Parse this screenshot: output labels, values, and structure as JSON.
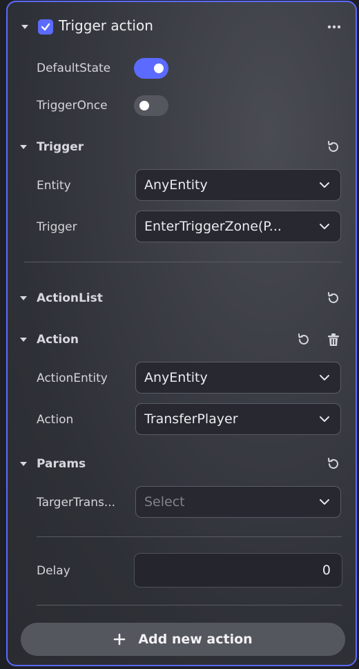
{
  "header": {
    "title": "Trigger action",
    "checked": true,
    "more_icon": "more-horizontal-icon"
  },
  "toggles": {
    "default_state": {
      "label": "DefaultState",
      "on": true
    },
    "trigger_once": {
      "label": "TriggerOnce",
      "on": false
    }
  },
  "trigger_section": {
    "title": "Trigger",
    "entity": {
      "label": "Entity",
      "value": "AnyEntity"
    },
    "trigger": {
      "label": "Trigger",
      "value": "EnterTriggerZone(P..."
    }
  },
  "action_list": {
    "title": "ActionList"
  },
  "action_section": {
    "title": "Action",
    "action_entity": {
      "label": "ActionEntity",
      "value": "AnyEntity"
    },
    "action": {
      "label": "Action",
      "value": "TransferPlayer"
    }
  },
  "params": {
    "title": "Params",
    "target_transform": {
      "label": "TargerTrans...",
      "placeholder": "Select"
    }
  },
  "delay": {
    "label": "Delay",
    "value": "0"
  },
  "add_action": {
    "label": "Add new action"
  },
  "colors": {
    "accent": "#5b6bff",
    "panel": "#34363d",
    "field": "#272830"
  }
}
